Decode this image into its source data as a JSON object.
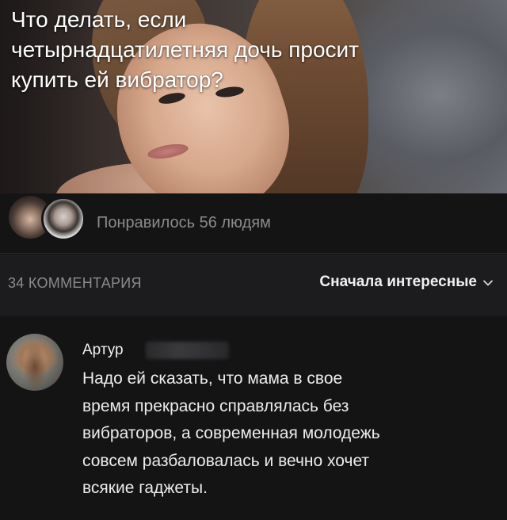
{
  "post": {
    "title": "Что делать, если\nчетырнадцатилетняя дочь просит\nкупить ей вибратор?"
  },
  "likes": {
    "text": "Понравилось 56 людям"
  },
  "comments": {
    "count_label": "34 КОММЕНТАРИЯ",
    "sort_label": "Сначала интересные",
    "sort_icon": "chevron-down-icon"
  },
  "comment": {
    "author": "Артур",
    "text": "Надо ей сказать, что мама в свое\nвремя прекрасно справлялась без\nвибраторов, а современная молодежь\nсовсем разбаловалась и вечно хочет\nвсякие гаджеты."
  },
  "colors": {
    "background": "#141415",
    "header_background": "#1c1c1e",
    "muted_text": "#8b8b8f",
    "primary_text": "#ececec"
  }
}
